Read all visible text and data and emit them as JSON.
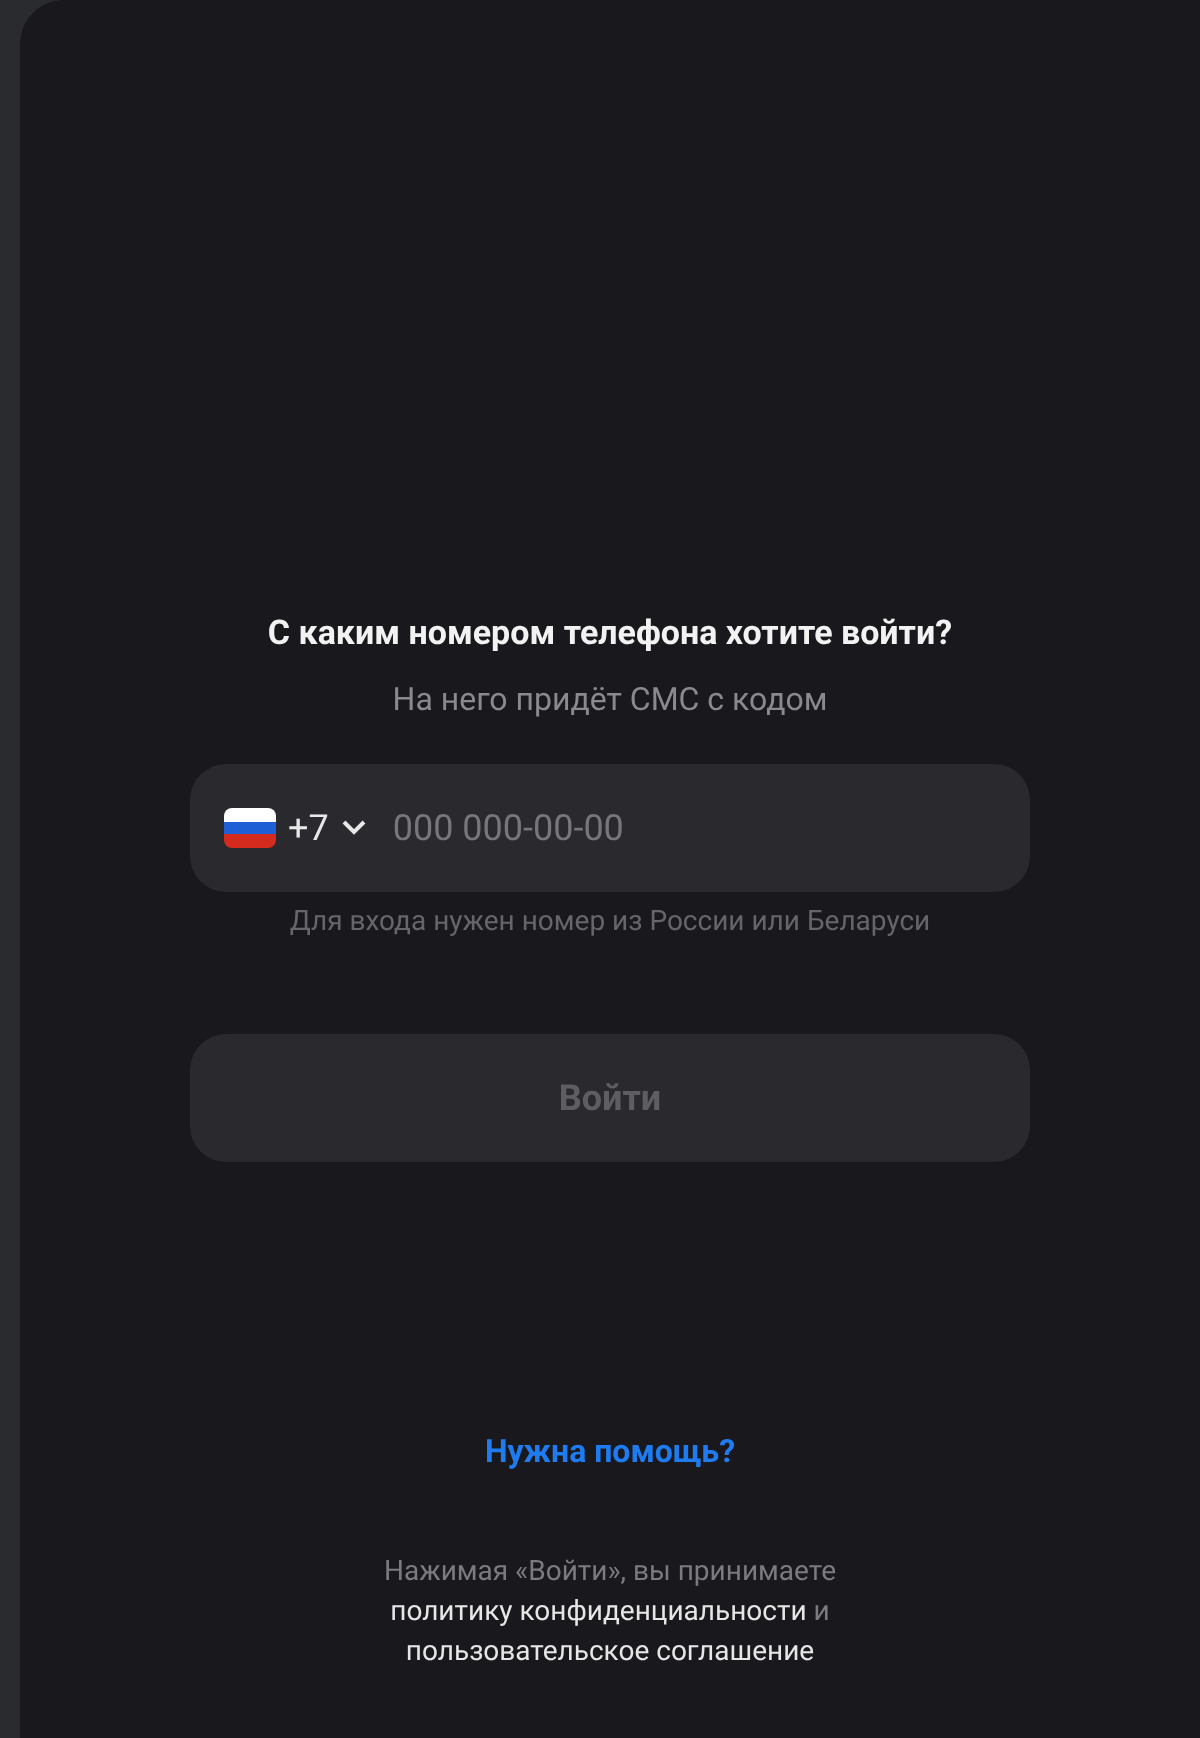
{
  "title": "С каким номером телефона хотите войти?",
  "subtitle": "На него придёт СМС с кодом",
  "phone": {
    "country_code": "+7",
    "placeholder": "000 000-00-00",
    "hint": "Для входа нужен номер из России или Беларуси"
  },
  "submit": {
    "label": "Войти",
    "disabled": true
  },
  "help_link": "Нужна помощь?",
  "legal": [
    {
      "kind": "text",
      "text": "Нажимая «Войти», вы принимаете "
    },
    {
      "kind": "link",
      "text": "политику конфиденциальности"
    },
    {
      "kind": "text",
      "text": " и "
    },
    {
      "kind": "link",
      "text": "пользовательское соглашение"
    }
  ]
}
